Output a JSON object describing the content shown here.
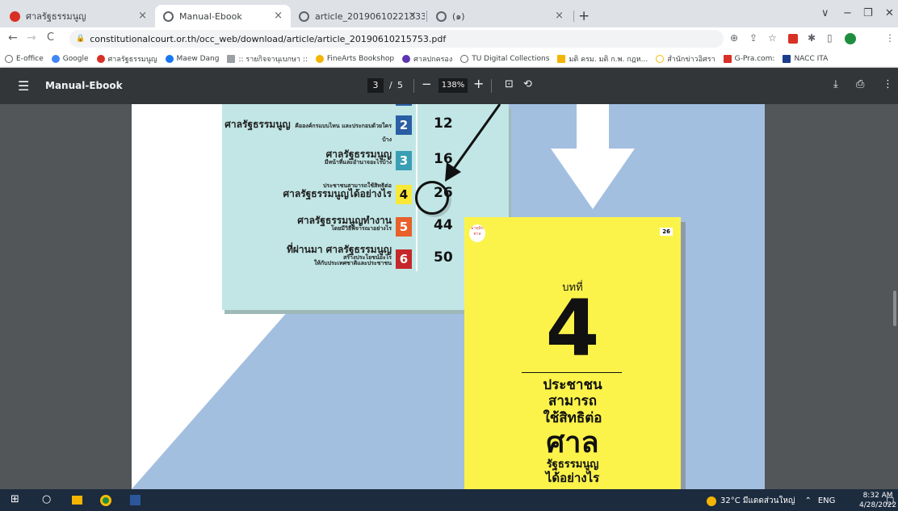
{
  "tabs": [
    {
      "title": "ศาลรัฐธรรมนูญ",
      "color": "#d93025",
      "close": "×"
    },
    {
      "title": "Manual-Ebook",
      "color": "#5f6368",
      "close": "×"
    },
    {
      "title": "article_20190610221333.pdf",
      "color": "#5f6368",
      "close": "×"
    },
    {
      "title": "(๑)",
      "color": "#5f6368",
      "close": "×"
    }
  ],
  "new_tab": "+",
  "window_controls": {
    "chevron": "∨",
    "minimize": "−",
    "restore": "❐",
    "close": "✕"
  },
  "toolbar": {
    "back": "←",
    "forward": "→",
    "reload": "C",
    "url": "constitutionalcourt.or.th/occ_web/download/article/article_20190610215753.pdf"
  },
  "bookmarks": [
    {
      "label": "E-office",
      "color": "#5f6368"
    },
    {
      "label": "Google",
      "color": "#4285f4"
    },
    {
      "label": "ศาลรัฐธรรมนูญ",
      "color": "#d93025"
    },
    {
      "label": "Maew Dang",
      "color": "#1877f2"
    },
    {
      "label": ":: รายกิจจานุเบกษา ::",
      "color": "#9aa0a6"
    },
    {
      "label": "FineArts Bookshop",
      "color": "#f4b400"
    },
    {
      "label": "ศาลปกครอง",
      "color": "#5e35b1"
    },
    {
      "label": "TU Digital Collections",
      "color": "#5f6368"
    },
    {
      "label": "มติ ครม. มติ ก.พ. กฎห...",
      "color": "#f4b400"
    },
    {
      "label": "สำนักข่าวอิศรา",
      "color": "#fbbc04"
    },
    {
      "label": "G-Pra.com:",
      "color": "#d93025"
    },
    {
      "label": "NACC ITA",
      "color": "#1a3e8c"
    }
  ],
  "pdf": {
    "title": "Manual-Ebook",
    "page_current": "3",
    "page_sep": "/",
    "page_total": "5",
    "zoom_out": "−",
    "zoom": "138%",
    "zoom_in": "+"
  },
  "toc": [
    {
      "big": "ศาลรัฐธรรมนูญ",
      "small": "คือองค์กรแบบไหน\nและประกอบด้วยใครบ้าง",
      "num": "2",
      "color": "#2a5ea5",
      "page": "12"
    },
    {
      "big": "ศาลรัฐธรรมนูญ",
      "small": "มีหน้าที่และอำนาจอะไรบ้าง",
      "num": "3",
      "color": "#3a9fb5",
      "page": "16"
    },
    {
      "big": "ศาลรัฐธรรมนูญได้อย่างไร",
      "small": "ประชาชนสามารถใช้สิทธิต่อ",
      "num": "4",
      "color": "#f8e838",
      "page": "26"
    },
    {
      "big": "ศาลรัฐธรรมนูญทำงาน",
      "small": "โดยมีวิธีพิจารณาอย่างไร",
      "num": "5",
      "color": "#e8602a",
      "page": "44"
    },
    {
      "big": "ที่ผ่านมา ศาลรัฐธรรมนูญ",
      "small": "สร้างประโยชน์อะไร\nให้กับประเทศชาติและประชาชน",
      "num": "6",
      "color": "#c5282a",
      "page": "50"
    }
  ],
  "chapter_page": {
    "logo_text": "มาตุลิก ศาล",
    "page_number": "26",
    "label": "บทที่",
    "number": "4",
    "title_lines": [
      "ประชาชน",
      "สามารถ",
      "ใช้สิทธิต่อ",
      "ศาล",
      "รัฐธรรมนูญ",
      "ได้อย่างไร"
    ]
  },
  "taskbar": {
    "weather": "32°C มีแดดส่วนใหญ่",
    "lang": "ENG",
    "time": "8:32 AM",
    "date": "4/28/2022"
  }
}
